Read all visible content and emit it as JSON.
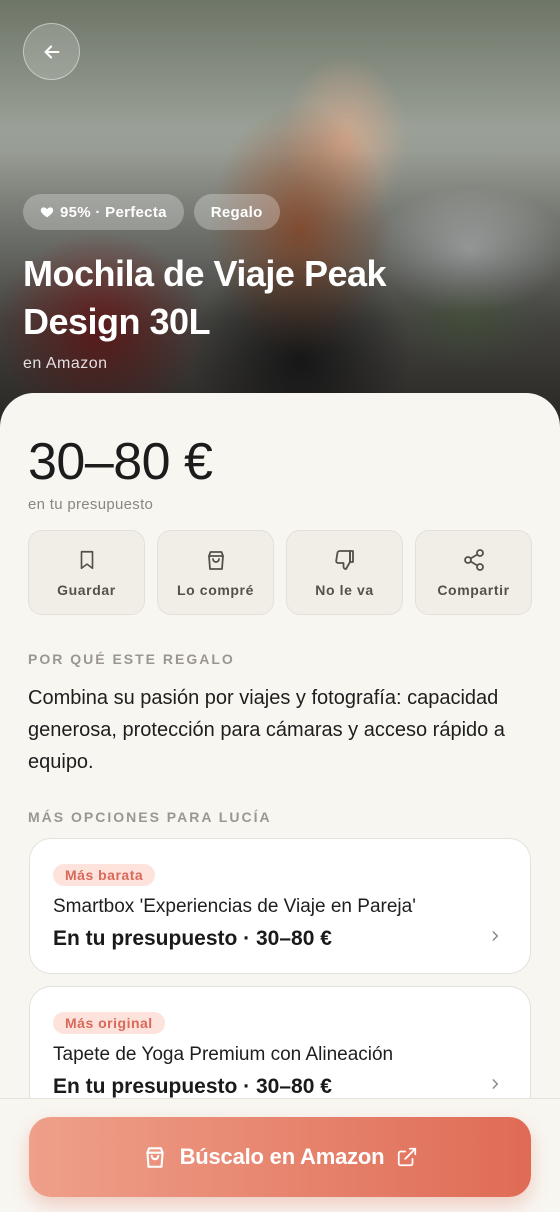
{
  "hero": {
    "match_chip": "95% · Perfecta",
    "category_chip": "Regalo",
    "title": "Mochila de Viaje Peak Design 30L",
    "store": "en Amazon"
  },
  "price": {
    "range": "30–80 €",
    "note": "en tu presupuesto"
  },
  "actions": [
    {
      "label": "Guardar",
      "icon": "bookmark-icon"
    },
    {
      "label": "Lo compré",
      "icon": "shopping-bag-icon"
    },
    {
      "label": "No le va",
      "icon": "thumbs-down-icon"
    },
    {
      "label": "Compartir",
      "icon": "share-icon"
    }
  ],
  "why": {
    "heading": "POR QUÉ ESTE REGALO",
    "text": "Combina su pasión por viajes y fotografía: capacidad generosa, protección para cámaras y acceso rápido a equipo."
  },
  "more": {
    "heading": "MÁS OPCIONES PARA LUCÍA",
    "items": [
      {
        "tag": "Más barata",
        "title": "Smartbox 'Experiencias de Viaje en Pareja'",
        "meta": "En tu presupuesto · 30–80 €"
      },
      {
        "tag": "Más original",
        "title": "Tapete de Yoga Premium con Alineación",
        "meta": "En tu presupuesto · 30–80 €"
      }
    ]
  },
  "cta": {
    "label": "Búscalo en Amazon"
  },
  "colors": {
    "accent_start": "#efa08a",
    "accent_end": "#df6b55",
    "tag_bg": "#fde3dc",
    "tag_text": "#d9695a",
    "background": "#f8f6f1"
  }
}
